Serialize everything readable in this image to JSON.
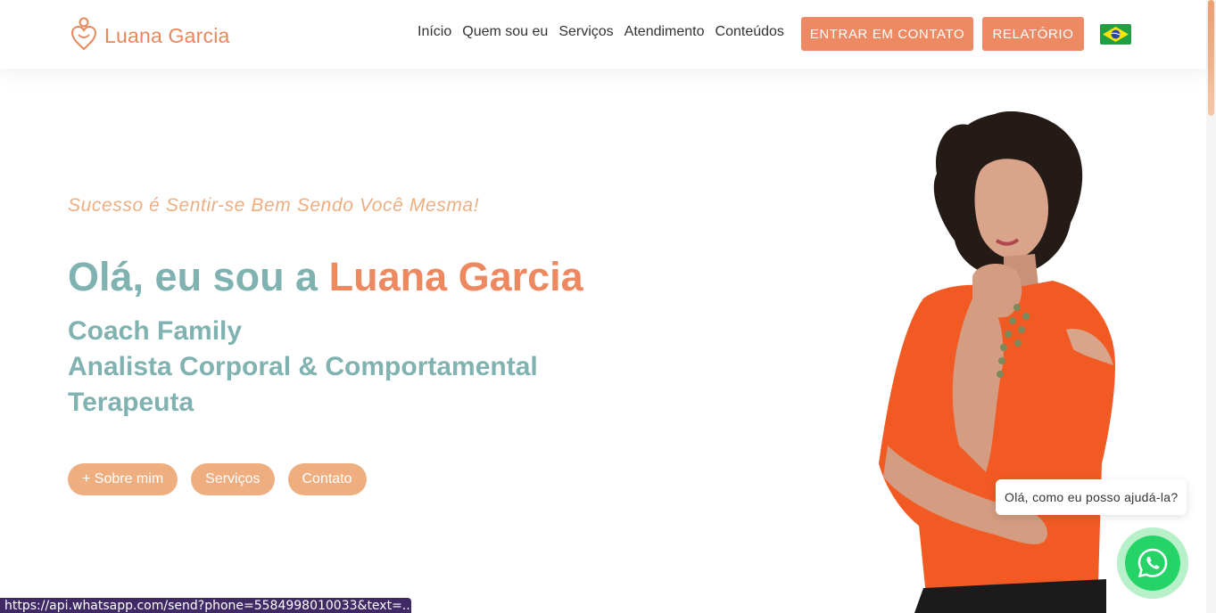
{
  "header": {
    "logo_text": "Luana Garcia",
    "nav": [
      "Início",
      "Quem sou eu",
      "Serviços",
      "Atendimento",
      "Conteúdos"
    ],
    "contact_button": "ENTRAR EM CONTATO",
    "report_button": "RELATÓRIO",
    "flag_icon": "brazil-flag-icon"
  },
  "hero": {
    "tagline": "Sucesso é Sentir-se Bem Sendo Você Mesma!",
    "headline_prefix": "Olá, eu sou a ",
    "headline_name": "Luana Garcia",
    "roles": [
      "Coach Family",
      "Analista Corporal & Comportamental",
      "Terapeuta"
    ],
    "buttons": [
      "+ Sobre mim",
      "Serviços",
      "Contato"
    ]
  },
  "chat": {
    "bubble_text": "Olá, como eu posso ajudá-la?",
    "button_icon": "whatsapp-icon"
  },
  "status_bar": {
    "url": "https://api.whatsapp.com/send?phone=5584998010033&text=..."
  },
  "colors": {
    "accent": "#ed8a64",
    "teal": "#7fb2b0",
    "peach": "#efae7f",
    "whatsapp": "#25d366"
  }
}
